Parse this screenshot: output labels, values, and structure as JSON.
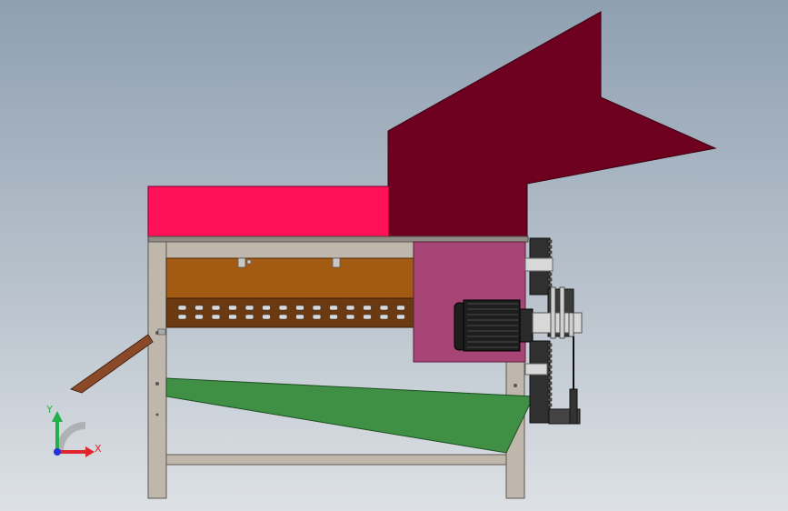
{
  "triad": {
    "y_label": "Y",
    "x_label": "X",
    "y_color": "#22b04a",
    "x_color": "#e0262b",
    "z_color": "#2233dd"
  },
  "colors": {
    "hopper": "#6e0020",
    "top_bin": "#ff1057",
    "frame": "#bfb6ac",
    "frame_edge": "#5e5852",
    "drum_upper": "#a35a12",
    "drum_lower": "#6b3a10",
    "housing": "#a84577",
    "chute": "#3f8f45",
    "ramp": "#8a4a2a",
    "motor": "#1e1e1e",
    "gear": "#303030",
    "shaft": "#d8d8d8"
  }
}
